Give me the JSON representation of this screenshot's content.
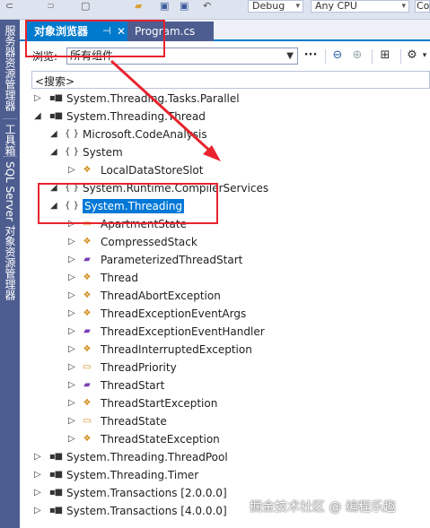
{
  "toolbar": {
    "config_value": "Debug",
    "platform_value": "Any CPU",
    "extra_value": "Co"
  },
  "side_tabs": [
    "服务器资源管理器",
    "工具箱",
    "SQL Server 对象资源管理器"
  ],
  "tabs": {
    "active_label": "对象浏览器",
    "pin_glyph": "⊣",
    "close_glyph": "✕",
    "inactive_label": "Program.cs"
  },
  "browse": {
    "label": "浏览:",
    "value": "所有组件"
  },
  "search": {
    "placeholder": "<搜索>"
  },
  "tree": [
    {
      "text": "System.Threading.Tasks.Parallel",
      "icon": "assembly",
      "expanded": false,
      "level": 0
    },
    {
      "text": "System.Threading.Thread",
      "icon": "assembly",
      "expanded": true,
      "level": 0
    },
    {
      "text": "Microsoft.CodeAnalysis",
      "icon": "namespace",
      "expanded": true,
      "level": 1
    },
    {
      "text": "System",
      "icon": "namespace",
      "expanded": true,
      "level": 1
    },
    {
      "text": "LocalDataStoreSlot",
      "icon": "class",
      "expanded": false,
      "level": 2
    },
    {
      "text": "System.Runtime.CompilerServices",
      "icon": "namespace",
      "expanded": true,
      "level": 1
    },
    {
      "text": "System.Threading",
      "icon": "namespace",
      "expanded": true,
      "level": 1,
      "selected": true
    },
    {
      "text": "ApartmentState",
      "icon": "enum",
      "expanded": false,
      "level": 2
    },
    {
      "text": "CompressedStack",
      "icon": "class",
      "expanded": false,
      "level": 2
    },
    {
      "text": "ParameterizedThreadStart",
      "icon": "delegate",
      "expanded": false,
      "level": 2
    },
    {
      "text": "Thread",
      "icon": "class",
      "expanded": false,
      "level": 2
    },
    {
      "text": "ThreadAbortException",
      "icon": "class",
      "expanded": false,
      "level": 2
    },
    {
      "text": "ThreadExceptionEventArgs",
      "icon": "class",
      "expanded": false,
      "level": 2
    },
    {
      "text": "ThreadExceptionEventHandler",
      "icon": "delegate",
      "expanded": false,
      "level": 2
    },
    {
      "text": "ThreadInterruptedException",
      "icon": "class",
      "expanded": false,
      "level": 2
    },
    {
      "text": "ThreadPriority",
      "icon": "enum",
      "expanded": false,
      "level": 2
    },
    {
      "text": "ThreadStart",
      "icon": "delegate",
      "expanded": false,
      "level": 2
    },
    {
      "text": "ThreadStartException",
      "icon": "class",
      "expanded": false,
      "level": 2
    },
    {
      "text": "ThreadState",
      "icon": "enum",
      "expanded": false,
      "level": 2
    },
    {
      "text": "ThreadStateException",
      "icon": "class",
      "expanded": false,
      "level": 2
    },
    {
      "text": "System.Threading.ThreadPool",
      "icon": "assembly",
      "expanded": false,
      "level": 0
    },
    {
      "text": "System.Threading.Timer",
      "icon": "assembly",
      "expanded": false,
      "level": 0
    },
    {
      "text": "System.Transactions [2.0.0.0]",
      "icon": "assembly",
      "expanded": false,
      "level": 0
    },
    {
      "text": "System.Transactions [4.0.0.0]",
      "icon": "assembly",
      "expanded": false,
      "level": 0
    }
  ],
  "watermark": "掘金技术社区 @ 编程乐趣",
  "colors": {
    "accent": "#007acc",
    "selection": "#0078d7",
    "annotation": "#e8232d"
  }
}
